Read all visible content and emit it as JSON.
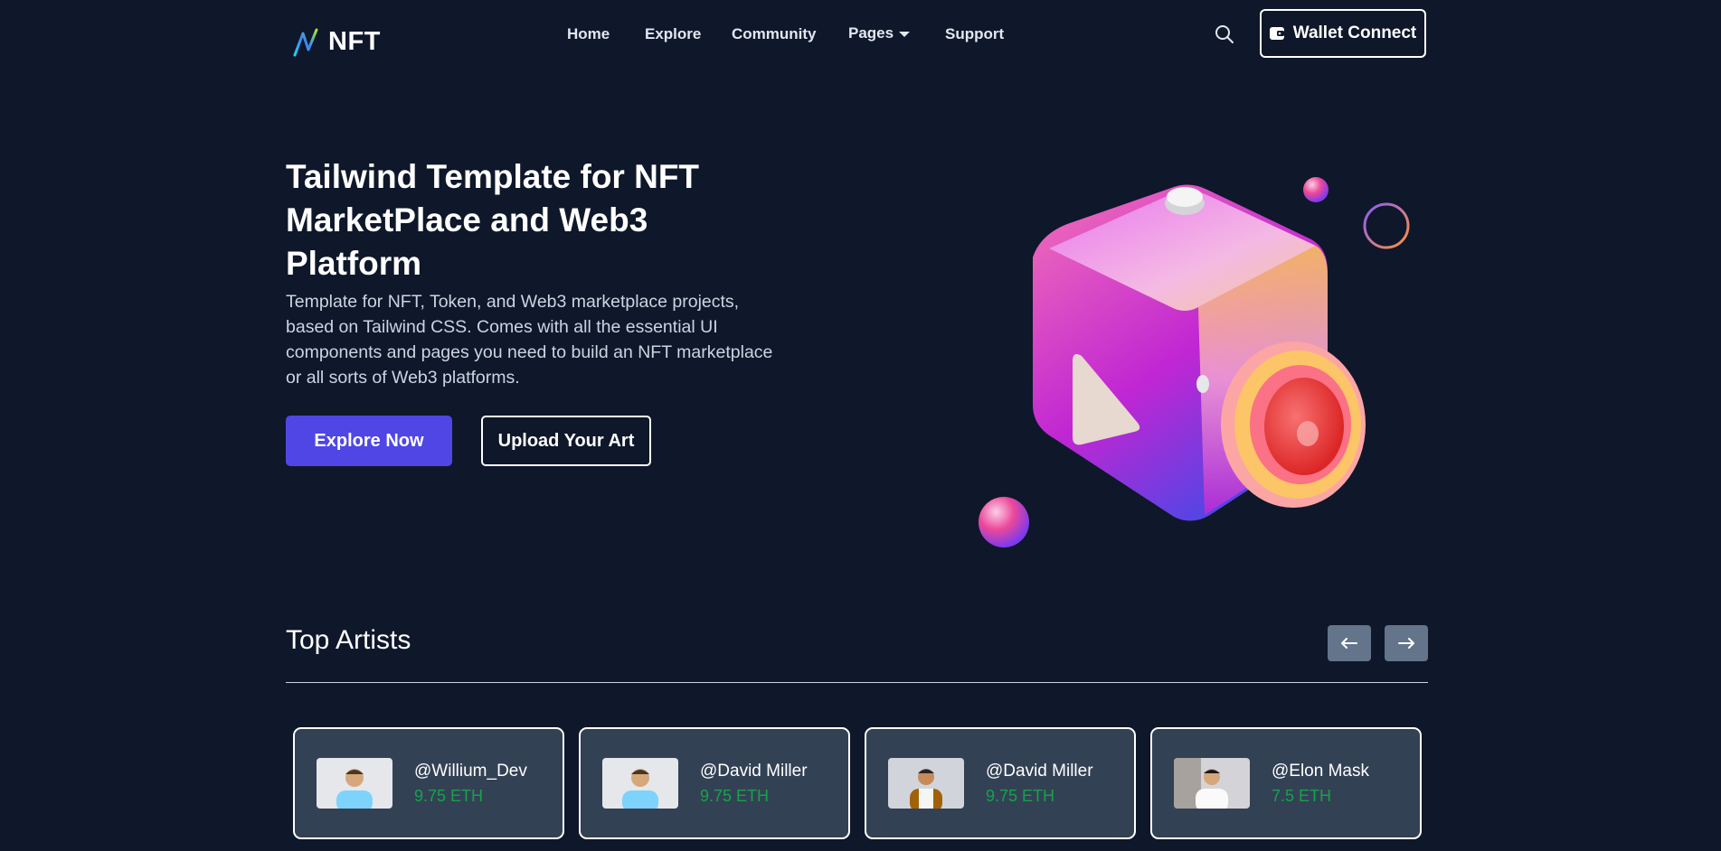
{
  "brand": {
    "name": "NFT"
  },
  "nav": {
    "items": [
      {
        "label": "Home"
      },
      {
        "label": "Explore"
      },
      {
        "label": "Community"
      },
      {
        "label": "Pages"
      },
      {
        "label": "Support"
      }
    ],
    "wallet_button": "Wallet Connect"
  },
  "hero": {
    "title": "Tailwind Template for NFT MarketPlace and Web3 Platform",
    "description": "Template for NFT, Token, and Web3 marketplace projects, based on Tailwind CSS. Comes with all the essential UI components and pages you need to build an NFT marketplace or all sorts of Web3 platforms.",
    "primary_button": "Explore Now",
    "secondary_button": "Upload Your Art"
  },
  "top_artists": {
    "title": "Top Artists",
    "prev_icon": "arrow-left-icon",
    "next_icon": "arrow-right-icon",
    "artists": [
      {
        "handle": "@Willium_Dev",
        "price": "9.75 ETH"
      },
      {
        "handle": "@David Miller",
        "price": "9.75 ETH"
      },
      {
        "handle": "@David Miller",
        "price": "9.75 ETH"
      },
      {
        "handle": "@Elon Mask",
        "price": "7.5 ETH"
      }
    ]
  },
  "colors": {
    "background": "#0f172a",
    "primary": "#4f46e5",
    "card": "#334155",
    "price": "#16a34a",
    "arrow_button": "#64748b"
  }
}
